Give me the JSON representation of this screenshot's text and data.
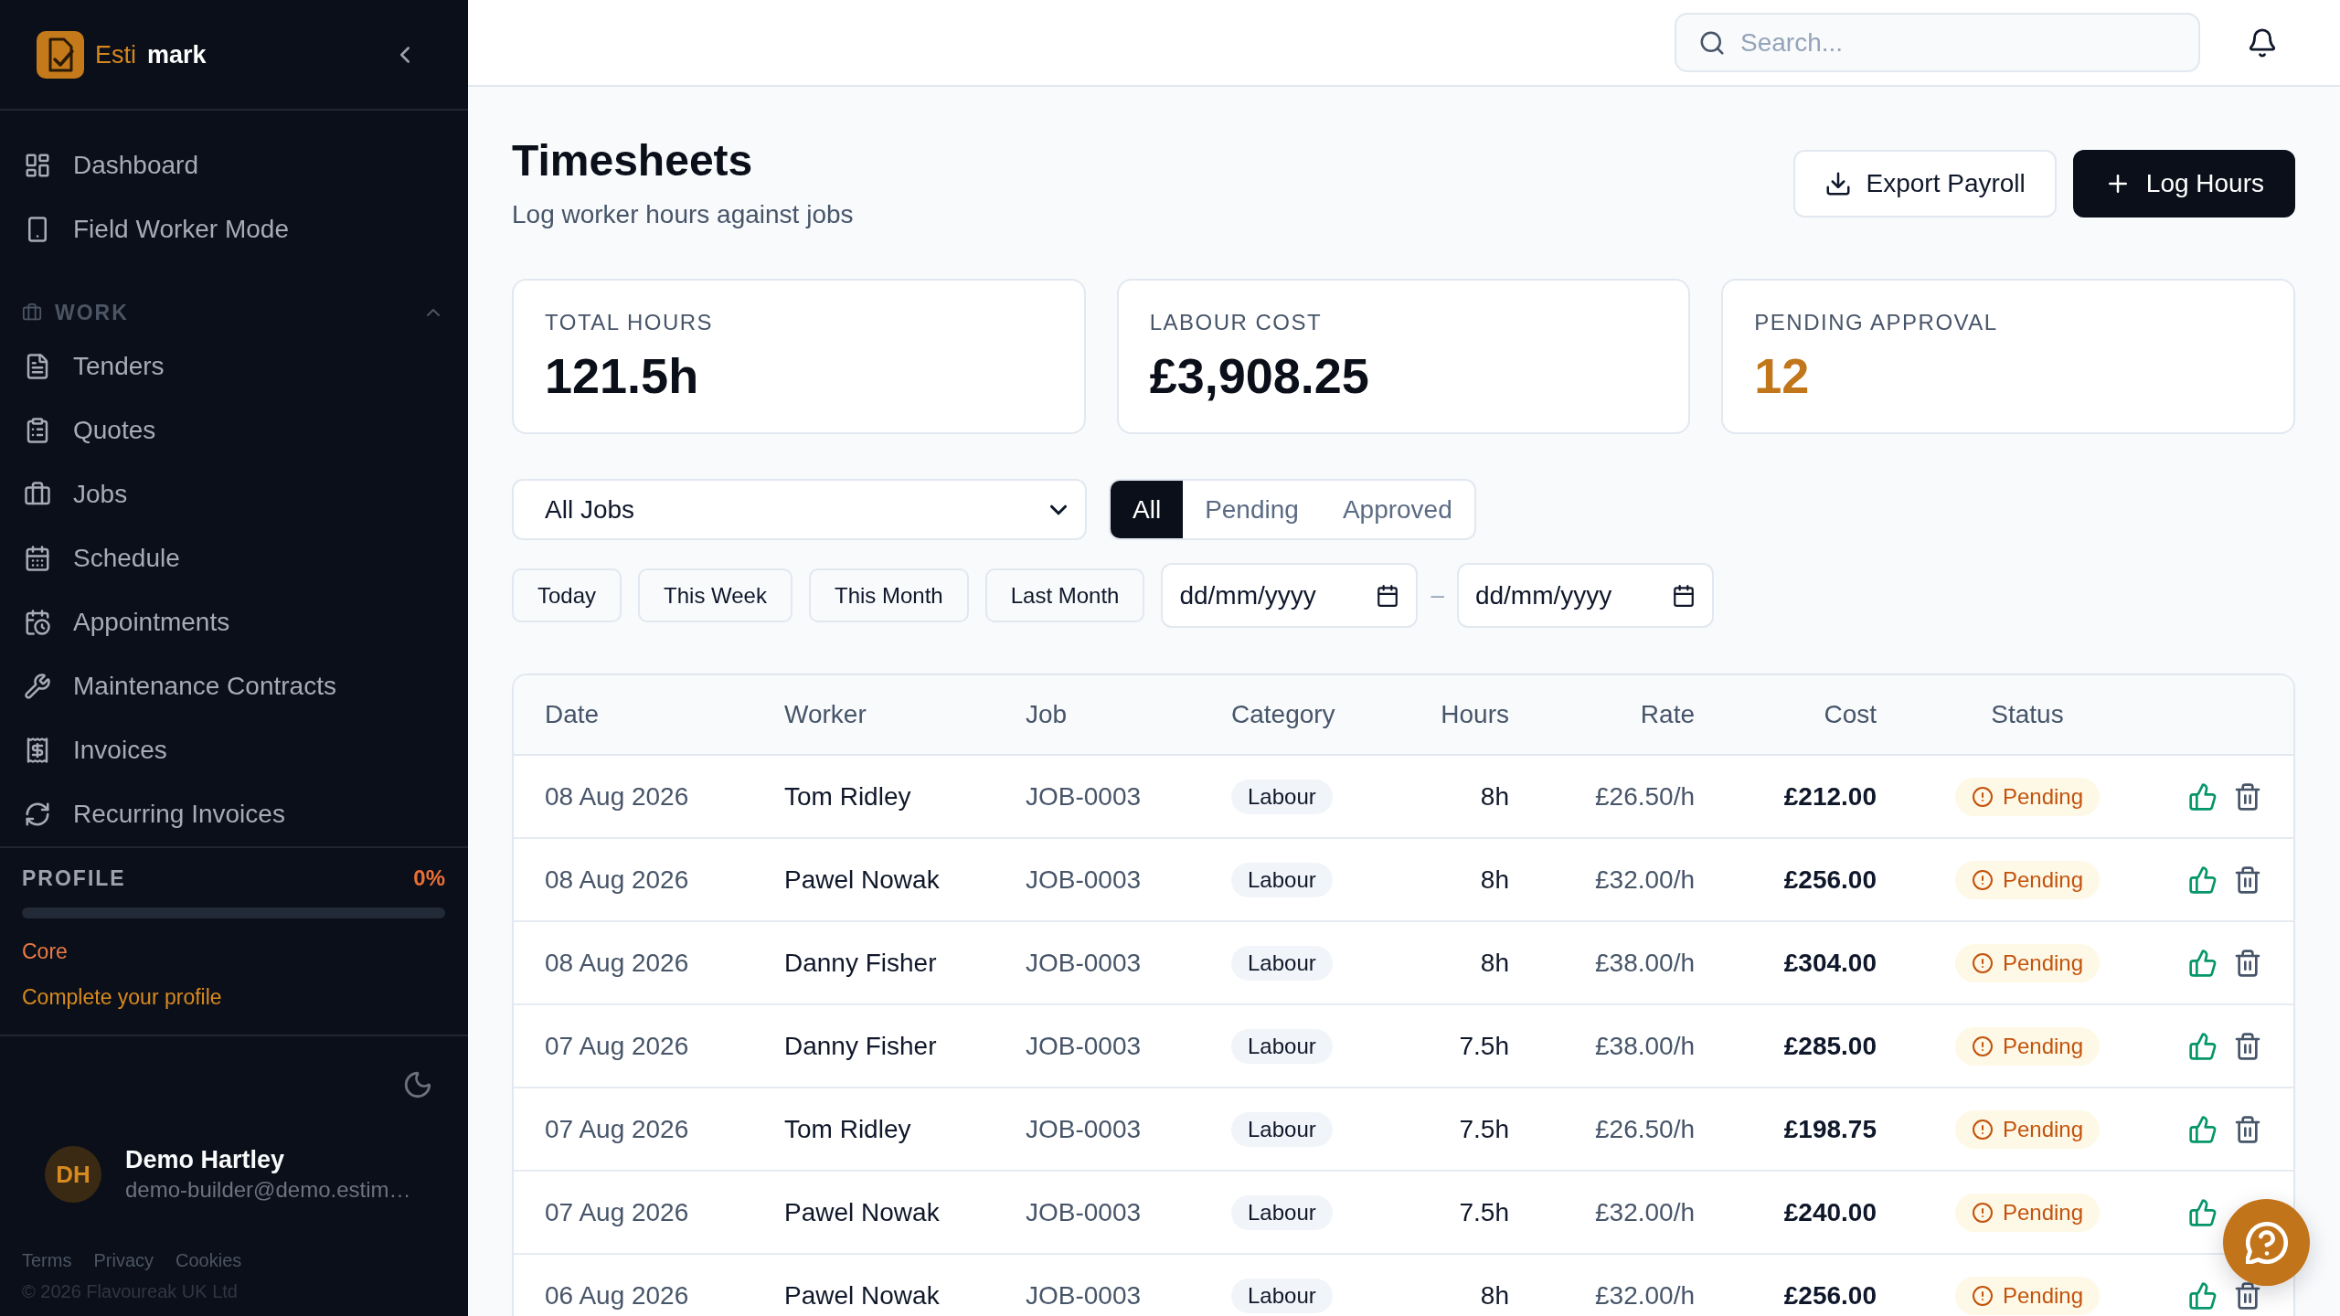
{
  "sidebar": {
    "brand": {
      "first": "Esti",
      "second": "mark"
    },
    "nav_items": [
      "Dashboard",
      "Field Worker Mode"
    ],
    "sections": [
      {
        "title": "WORK",
        "expanded": true,
        "items": [
          "Tenders",
          "Quotes",
          "Jobs",
          "Schedule",
          "Appointments",
          "Maintenance Contracts",
          "Invoices",
          "Recurring Invoices"
        ]
      }
    ],
    "profile": {
      "title": "PROFILE",
      "percent": "0%",
      "tier": "Core",
      "link": "Complete your profile"
    },
    "user": {
      "initials": "DH",
      "name": "Demo Hartley",
      "email": "demo-builder@demo.estim…"
    },
    "footer_links": [
      "Terms",
      "Privacy",
      "Cookies"
    ],
    "copyright": "© 2026 Flavoureak UK Ltd"
  },
  "top_bar": {
    "search": {
      "placeholder": "Search..."
    }
  },
  "page": {
    "title": "Timesheets",
    "subtitle": "Log worker hours against jobs",
    "actions": [
      {
        "label": "Export Payroll",
        "kind": "secondary"
      },
      {
        "label": "Log Hours",
        "kind": "primary"
      }
    ]
  },
  "stats": [
    {
      "label": "TOTAL HOURS",
      "value": "121.5h",
      "color": "#0b0f19"
    },
    {
      "label": "LABOUR COST",
      "value": "£3,908.25",
      "color": "#0b0f19"
    },
    {
      "label": "PENDING APPROVAL",
      "value": "12",
      "color": "#c2761a"
    }
  ],
  "filters": {
    "job_select": {
      "value": "All Jobs"
    },
    "status_tabs": [
      {
        "label": "All",
        "selected": true
      },
      {
        "label": "Pending",
        "selected": false
      },
      {
        "label": "Approved",
        "selected": false
      }
    ],
    "date_presets": [
      "Today",
      "This Week",
      "This Month",
      "Last Month"
    ],
    "date_from": {
      "placeholder": "dd/mm/yyyy"
    },
    "date_separator": "–",
    "date_to": {
      "placeholder": "dd/mm/yyyy"
    }
  },
  "table": {
    "columns": [
      "Date",
      "Worker",
      "Job",
      "Category",
      "Hours",
      "Rate",
      "Cost",
      "Status"
    ],
    "rows": [
      {
        "date": "08 Aug 2026",
        "worker": "Tom Ridley",
        "job": "JOB-0003",
        "category": "Labour",
        "hours": "8h",
        "rate": "£26.50/h",
        "cost": "£212.00",
        "status": {
          "label": "Pending",
          "kind": "pending"
        }
      },
      {
        "date": "08 Aug 2026",
        "worker": "Pawel Nowak",
        "job": "JOB-0003",
        "category": "Labour",
        "hours": "8h",
        "rate": "£32.00/h",
        "cost": "£256.00",
        "status": {
          "label": "Pending",
          "kind": "pending"
        }
      },
      {
        "date": "08 Aug 2026",
        "worker": "Danny Fisher",
        "job": "JOB-0003",
        "category": "Labour",
        "hours": "8h",
        "rate": "£38.00/h",
        "cost": "£304.00",
        "status": {
          "label": "Pending",
          "kind": "pending"
        }
      },
      {
        "date": "07 Aug 2026",
        "worker": "Danny Fisher",
        "job": "JOB-0003",
        "category": "Labour",
        "hours": "7.5h",
        "rate": "£38.00/h",
        "cost": "£285.00",
        "status": {
          "label": "Pending",
          "kind": "pending"
        }
      },
      {
        "date": "07 Aug 2026",
        "worker": "Tom Ridley",
        "job": "JOB-0003",
        "category": "Labour",
        "hours": "7.5h",
        "rate": "£26.50/h",
        "cost": "£198.75",
        "status": {
          "label": "Pending",
          "kind": "pending"
        }
      },
      {
        "date": "07 Aug 2026",
        "worker": "Pawel Nowak",
        "job": "JOB-0003",
        "category": "Labour",
        "hours": "7.5h",
        "rate": "£32.00/h",
        "cost": "£240.00",
        "status": {
          "label": "Pending",
          "kind": "pending"
        }
      },
      {
        "date": "06 Aug 2026",
        "worker": "Pawel Nowak",
        "job": "JOB-0003",
        "category": "Labour",
        "hours": "8h",
        "rate": "£32.00/h",
        "cost": "£256.00",
        "status": {
          "label": "Pending",
          "kind": "pending"
        }
      }
    ]
  }
}
